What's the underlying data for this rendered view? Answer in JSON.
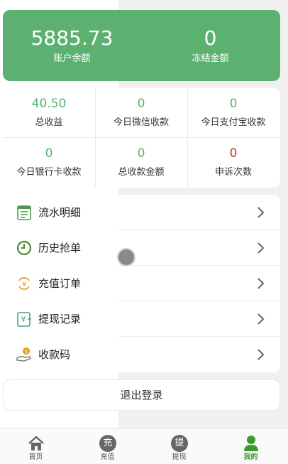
{
  "balance": {
    "account_value": "5885.73",
    "account_label": "账户余额",
    "frozen_value": "0",
    "frozen_label": "冻结金额"
  },
  "stats": [
    {
      "value": "40.50",
      "label": "总收益"
    },
    {
      "value": "0",
      "label": "今日微信收款"
    },
    {
      "value": "0",
      "label": "今日支付宝收款"
    },
    {
      "value": "0",
      "label": "今日银行卡收款"
    },
    {
      "value": "0",
      "label": "总收款金额"
    },
    {
      "value": "0",
      "label": "申诉次数"
    }
  ],
  "menu": [
    {
      "label": "流水明细",
      "icon": "ledger-icon"
    },
    {
      "label": "历史抢单",
      "icon": "clock-icon"
    },
    {
      "label": "充值订单",
      "icon": "yuan-cycle-icon"
    },
    {
      "label": "提现记录",
      "icon": "withdraw-record-icon"
    },
    {
      "label": "收款码",
      "icon": "money-hand-icon"
    }
  ],
  "logout_label": "退出登录",
  "tabs": [
    {
      "label": "首页",
      "icon": "home-icon",
      "glyph": ""
    },
    {
      "label": "充值",
      "icon": "recharge-icon",
      "glyph": "充"
    },
    {
      "label": "提现",
      "icon": "withdraw-icon",
      "glyph": "提"
    },
    {
      "label": "我的",
      "icon": "user-icon",
      "glyph": "",
      "active": true
    }
  ],
  "colors": {
    "accent": "#5cb170",
    "appeal": "#c0392b",
    "active_tab": "#3a9a2a"
  }
}
